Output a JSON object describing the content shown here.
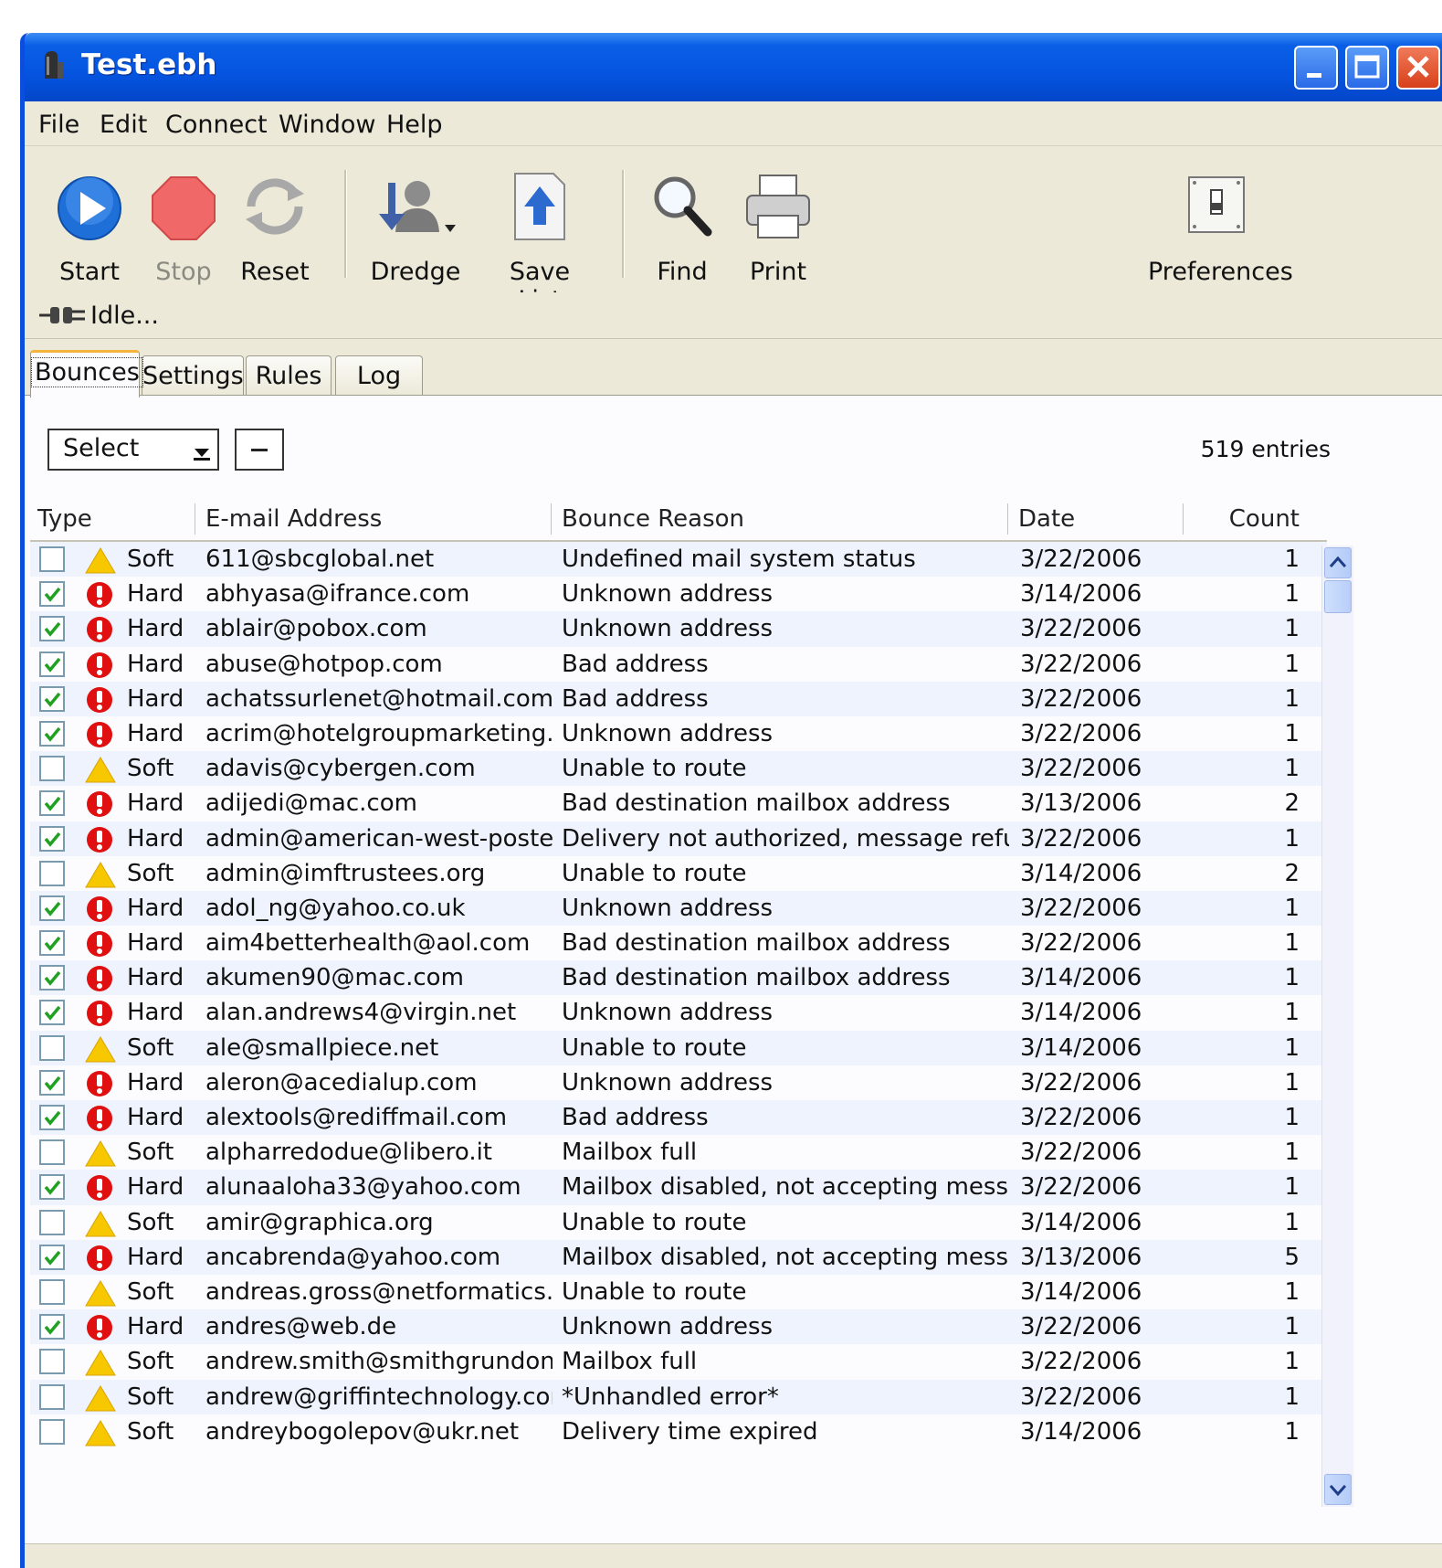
{
  "window": {
    "title": "Test.ebh"
  },
  "menu": [
    "File",
    "Edit",
    "Connect",
    "Window",
    "Help"
  ],
  "toolbar": {
    "start": "Start",
    "stop": "Stop",
    "reset": "Reset",
    "dredge": "Dredge",
    "save_list": "Save List",
    "find": "Find",
    "print": "Print",
    "preferences": "Preferences"
  },
  "status": {
    "text": "Idle..."
  },
  "tabs": [
    "Bounces",
    "Settings",
    "Rules",
    "Log"
  ],
  "filter": {
    "select_value": "Select",
    "entries": "519 entries"
  },
  "table": {
    "headers": {
      "type": "Type",
      "email": "E-mail Address",
      "reason": "Bounce Reason",
      "date": "Date",
      "count": "Count"
    },
    "rows": [
      {
        "checked": false,
        "type": "Soft",
        "email": "611@sbcglobal.net",
        "reason": "Undefined mail system status",
        "date": "3/22/2006",
        "count": "1"
      },
      {
        "checked": true,
        "type": "Hard",
        "email": "abhyasa@ifrance.com",
        "reason": "Unknown address",
        "date": "3/14/2006",
        "count": "1"
      },
      {
        "checked": true,
        "type": "Hard",
        "email": "ablair@pobox.com",
        "reason": "Unknown address",
        "date": "3/22/2006",
        "count": "1"
      },
      {
        "checked": true,
        "type": "Hard",
        "email": "abuse@hotpop.com",
        "reason": "Bad address",
        "date": "3/22/2006",
        "count": "1"
      },
      {
        "checked": true,
        "type": "Hard",
        "email": "achatssurlenet@hotmail.com",
        "reason": "Bad address",
        "date": "3/22/2006",
        "count": "1"
      },
      {
        "checked": true,
        "type": "Hard",
        "email": "acrim@hotelgroupmarketing.com",
        "reason": "Unknown address",
        "date": "3/22/2006",
        "count": "1"
      },
      {
        "checked": false,
        "type": "Soft",
        "email": "adavis@cybergen.com",
        "reason": "Unable to route",
        "date": "3/22/2006",
        "count": "1"
      },
      {
        "checked": true,
        "type": "Hard",
        "email": "adijedi@mac.com",
        "reason": "Bad destination mailbox address",
        "date": "3/13/2006",
        "count": "2"
      },
      {
        "checked": true,
        "type": "Hard",
        "email": "admin@american-west-poster…",
        "reason": "Delivery not authorized, message refused",
        "date": "3/22/2006",
        "count": "1"
      },
      {
        "checked": false,
        "type": "Soft",
        "email": "admin@imftrustees.org",
        "reason": "Unable to route",
        "date": "3/14/2006",
        "count": "2"
      },
      {
        "checked": true,
        "type": "Hard",
        "email": "adol_ng@yahoo.co.uk",
        "reason": "Unknown address",
        "date": "3/22/2006",
        "count": "1"
      },
      {
        "checked": true,
        "type": "Hard",
        "email": "aim4betterhealth@aol.com",
        "reason": "Bad destination mailbox address",
        "date": "3/22/2006",
        "count": "1"
      },
      {
        "checked": true,
        "type": "Hard",
        "email": "akumen90@mac.com",
        "reason": "Bad destination mailbox address",
        "date": "3/14/2006",
        "count": "1"
      },
      {
        "checked": true,
        "type": "Hard",
        "email": "alan.andrews4@virgin.net",
        "reason": "Unknown address",
        "date": "3/14/2006",
        "count": "1"
      },
      {
        "checked": false,
        "type": "Soft",
        "email": "ale@smallpiece.net",
        "reason": "Unable to route",
        "date": "3/14/2006",
        "count": "1"
      },
      {
        "checked": true,
        "type": "Hard",
        "email": "aleron@acedialup.com",
        "reason": "Unknown address",
        "date": "3/22/2006",
        "count": "1"
      },
      {
        "checked": true,
        "type": "Hard",
        "email": "alextools@rediffmail.com",
        "reason": "Bad address",
        "date": "3/22/2006",
        "count": "1"
      },
      {
        "checked": false,
        "type": "Soft",
        "email": "alpharredodue@libero.it",
        "reason": "Mailbox full",
        "date": "3/22/2006",
        "count": "1"
      },
      {
        "checked": true,
        "type": "Hard",
        "email": "alunaaloha33@yahoo.com",
        "reason": "Mailbox disabled, not accepting messages",
        "date": "3/22/2006",
        "count": "1"
      },
      {
        "checked": false,
        "type": "Soft",
        "email": "amir@graphica.org",
        "reason": "Unable to route",
        "date": "3/14/2006",
        "count": "1"
      },
      {
        "checked": true,
        "type": "Hard",
        "email": "ancabrenda@yahoo.com",
        "reason": "Mailbox disabled, not accepting messages",
        "date": "3/13/2006",
        "count": "5"
      },
      {
        "checked": false,
        "type": "Soft",
        "email": "andreas.gross@netformatics.de",
        "reason": "Unable to route",
        "date": "3/14/2006",
        "count": "1"
      },
      {
        "checked": true,
        "type": "Hard",
        "email": "andres@web.de",
        "reason": "Unknown address",
        "date": "3/22/2006",
        "count": "1"
      },
      {
        "checked": false,
        "type": "Soft",
        "email": "andrew.smith@smithgrundon.…",
        "reason": "Mailbox full",
        "date": "3/22/2006",
        "count": "1"
      },
      {
        "checked": false,
        "type": "Soft",
        "email": "andrew@griffintechnology.com",
        "reason": "*Unhandled error*",
        "date": "3/22/2006",
        "count": "1"
      },
      {
        "checked": false,
        "type": "Soft",
        "email": "andreybogolepov@ukr.net",
        "reason": "Delivery time expired",
        "date": "3/14/2006",
        "count": "1"
      }
    ]
  }
}
